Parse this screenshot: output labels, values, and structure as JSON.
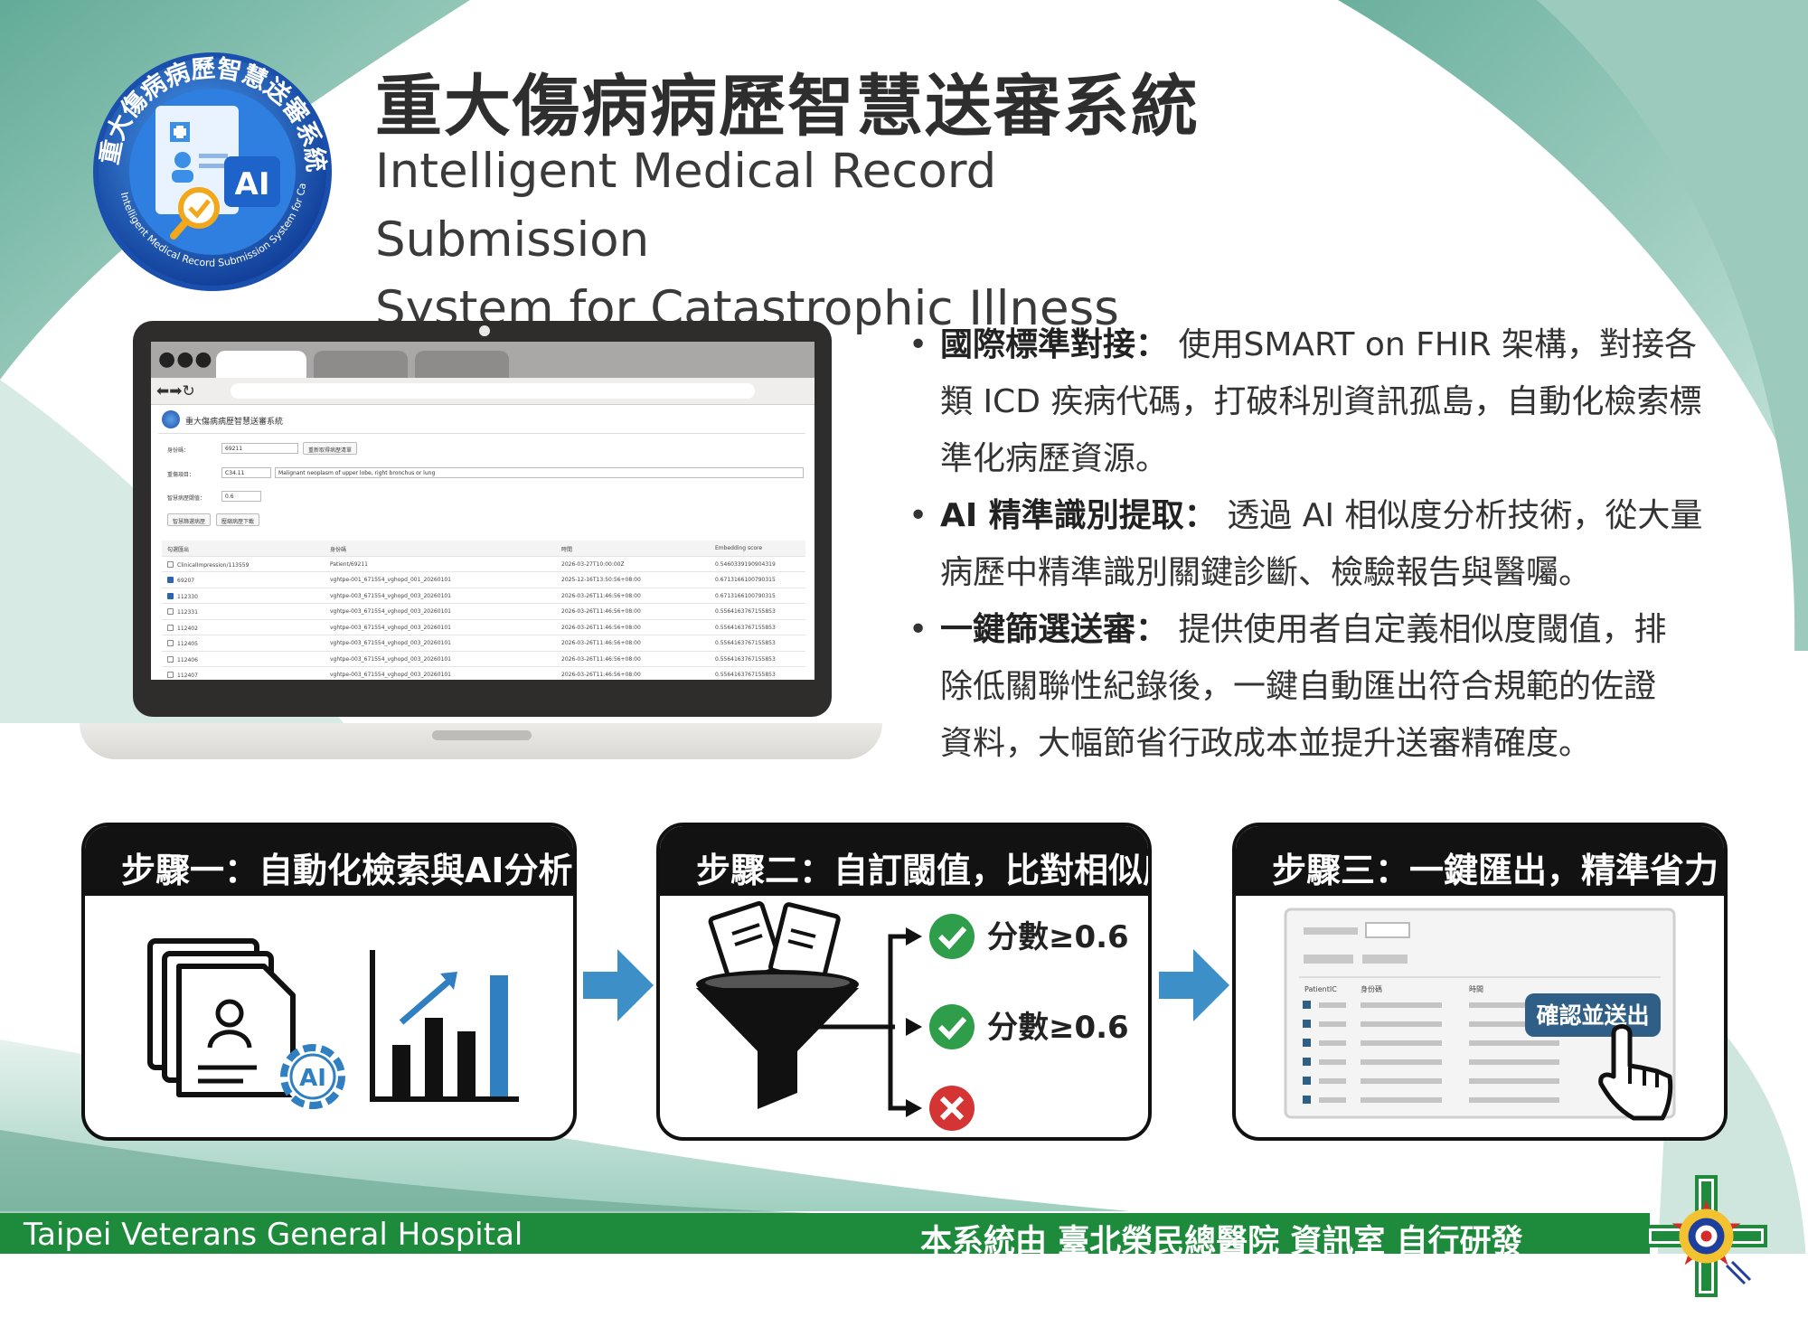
{
  "header": {
    "title_zh": "重大傷病病歷智慧送審系統",
    "title_en_line1": "Intelligent Medical Record Submission",
    "title_en_line2": "System for Catastrophic Illness",
    "logo_ring_text_zh": "重大傷病病歷智慧送審系統",
    "logo_ring_text_en": "Intelligent Medical Record Submission System for Catastrophic Illness",
    "logo_badge": "AI"
  },
  "app_screen": {
    "title": "重大傷病病歷智慧送審系統",
    "patient_label": "身份碼：",
    "patient_value": "69211",
    "refresh_button": "重新取得病歷清單",
    "diagnosis_label": "重傷項目：",
    "icd_value": "C34.11",
    "diagnosis_text": "Malignant neoplasm of upper lobe, right bronchus or lung",
    "threshold_label": "智慧病歷閾值：",
    "threshold_value": "0.6",
    "filter_button": "智慧篩選病歷",
    "download_button": "壓縮病歷下載",
    "columns": [
      "勾選匯出",
      "身份碼",
      "時間",
      "Embedding score"
    ],
    "rows": [
      {
        "checked": false,
        "id": "ClinicalImpression/113559",
        "ref": "Patient/69211",
        "time": "2026-03-27T10:00:00Z",
        "score": "0.5460339190904319"
      },
      {
        "checked": true,
        "id": "69207",
        "ref": "vghtpe-001_671554_vghopd_001_20260101",
        "time": "2025-12-16T13:50:56+08:00",
        "score": "0.6713166100790315"
      },
      {
        "checked": true,
        "id": "112330",
        "ref": "vghtpe-003_671554_vghopd_003_20260101",
        "time": "2026-03-26T11:46:56+08:00",
        "score": "0.6713166100790315"
      },
      {
        "checked": false,
        "id": "112331",
        "ref": "vghtpe-003_671554_vghopd_003_20260101",
        "time": "2026-03-26T11:46:56+08:00",
        "score": "0.5564163767155853"
      },
      {
        "checked": false,
        "id": "112402",
        "ref": "vghtpe-003_671554_vghopd_003_20260101",
        "time": "2026-03-26T11:46:56+08:00",
        "score": "0.5564163767155853"
      },
      {
        "checked": false,
        "id": "112405",
        "ref": "vghtpe-003_671554_vghopd_003_20260101",
        "time": "2026-03-26T11:46:56+08:00",
        "score": "0.5564163767155853"
      },
      {
        "checked": false,
        "id": "112406",
        "ref": "vghtpe-003_671554_vghopd_003_20260101",
        "time": "2026-03-26T11:46:56+08:00",
        "score": "0.5564163767155853"
      },
      {
        "checked": false,
        "id": "112407",
        "ref": "vghtpe-003_671554_vghopd_003_20260101",
        "time": "2026-03-26T11:46:56+08:00",
        "score": "0.5564163767155853"
      }
    ]
  },
  "bullets": [
    {
      "head": "國際標準對接：",
      "lines": [
        "使用SMART on FHIR 架構，對接各",
        "類 ICD 疾病代碼，打破科別資訊孤島，自動化檢索標",
        "準化病歷資源。"
      ]
    },
    {
      "head": "AI 精準識別提取：",
      "lines": [
        "透過 AI 相似度分析技術，從大量",
        "病歷中精準識別關鍵診斷、檢驗報告與醫囑。"
      ]
    },
    {
      "head": "一鍵篩選送審：",
      "lines": [
        "提供使用者自定義相似度閾值，排",
        "除低關聯性紀錄後，一鍵自動匯出符合規範的佐證",
        "資料，大幅節省行政成本並提升送審精確度。"
      ]
    }
  ],
  "steps": [
    {
      "title": "步驟一：自動化檢索與AI分析",
      "ai_badge": "AI"
    },
    {
      "title": "步驟二：自訂閾值，比對相似度",
      "pass1": "分數≥0.6",
      "pass2": "分數≥0.6"
    },
    {
      "title": "步驟三：一鍵匯出，精準省力",
      "export_button": "確認並送出",
      "mini_columns": [
        "PatientIC",
        "身份碼",
        "時間"
      ]
    }
  ],
  "footer": {
    "hospital_en": "Taipei Veterans General Hospital",
    "credit_zh": "本系統由 臺北榮民總醫院 資訊室 自行研發"
  },
  "colors": {
    "teal_bg": "#86c0b0",
    "teal_dark": "#4f9b87",
    "footer_green": "#1d8a3c",
    "step_header": "#121212",
    "arrow_blue": "#3d8fc8",
    "check_green": "#2e9e4a",
    "cross_red": "#d43434",
    "export_button": "#2f5f86"
  }
}
